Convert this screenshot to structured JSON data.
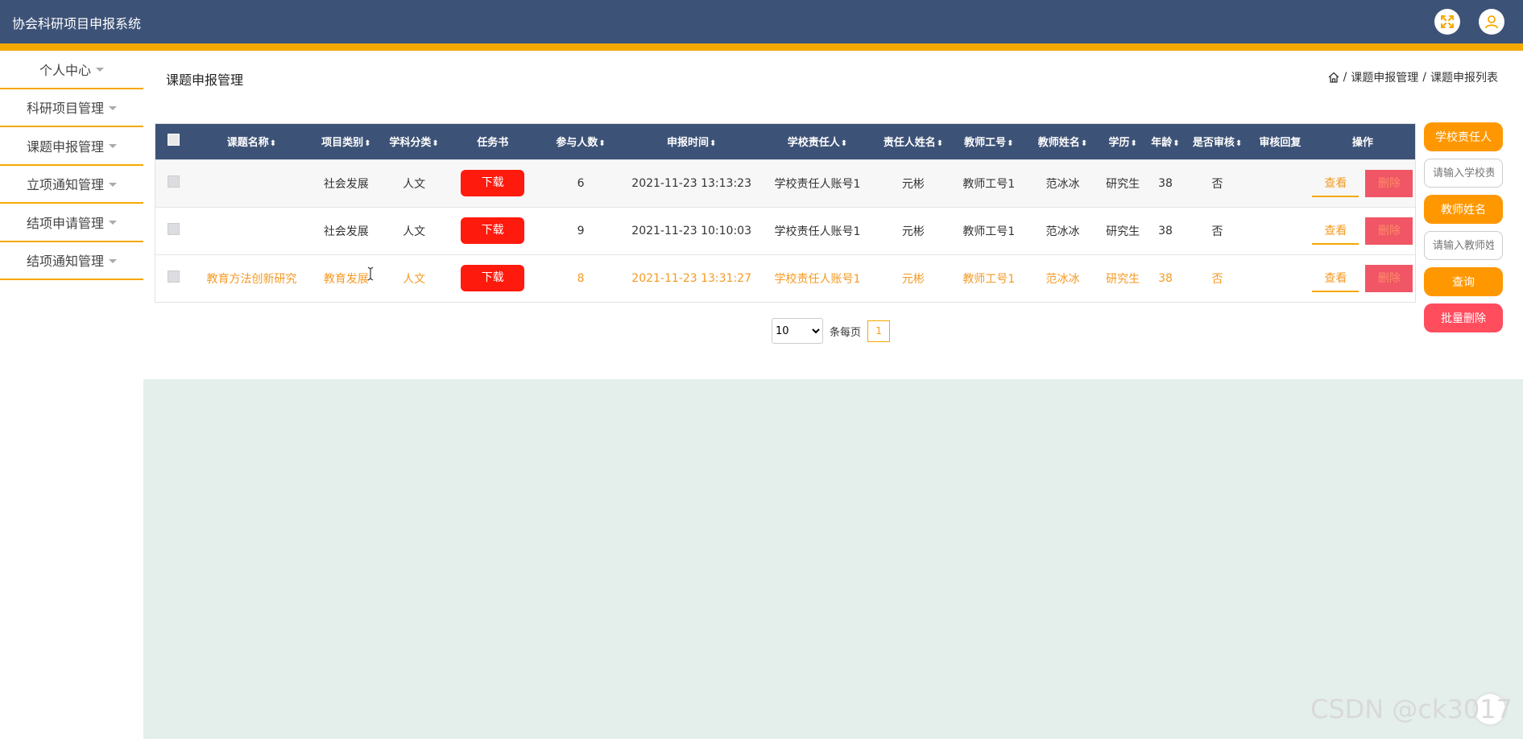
{
  "app": {
    "title": "协会科研项目申报系统"
  },
  "header": {
    "icons": [
      "fullscreen-icon",
      "user-icon"
    ]
  },
  "sidebar": {
    "items": [
      {
        "label": "个人中心"
      },
      {
        "label": "科研项目管理"
      },
      {
        "label": "课题申报管理"
      },
      {
        "label": "立项通知管理"
      },
      {
        "label": "结项申请管理"
      },
      {
        "label": "结项通知管理"
      }
    ]
  },
  "main": {
    "title": "课题申报管理"
  },
  "breadcrumb": {
    "home_icon": "home-icon",
    "items": [
      "课题申报管理",
      "课题申报列表"
    ],
    "sep": "/"
  },
  "table": {
    "headers": {
      "name": "课题名称",
      "category": "项目类别",
      "subject": "学科分类",
      "task": "任务书",
      "count": "参与人数",
      "time": "申报时间",
      "account": "学校责任人",
      "resp_name": "责任人姓名",
      "teacher_id": "教师工号",
      "teacher_name": "教师姓名",
      "edu": "学历",
      "age": "年龄",
      "audit": "是否审核",
      "reply": "审核回复",
      "ops": "操作"
    },
    "download_label": "下载",
    "view_label": "查看",
    "delete_label": "删除",
    "rows": [
      {
        "name": "",
        "category": "社会发展",
        "subject": "人文",
        "count": "6",
        "time": "2021-11-23 13:13:23",
        "account": "学校责任人账号1",
        "resp_name": "元彬",
        "teacher_id": "教师工号1",
        "teacher_name": "范冰冰",
        "edu": "研究生",
        "age": "38",
        "audit": "否",
        "reply": ""
      },
      {
        "name": "",
        "category": "社会发展",
        "subject": "人文",
        "count": "9",
        "time": "2021-11-23 10:10:03",
        "account": "学校责任人账号1",
        "resp_name": "元彬",
        "teacher_id": "教师工号1",
        "teacher_name": "范冰冰",
        "edu": "研究生",
        "age": "38",
        "audit": "否",
        "reply": ""
      },
      {
        "name": "教育方法创新研究",
        "category": "教育发展",
        "subject": "人文",
        "count": "8",
        "time": "2021-11-23 13:31:27",
        "account": "学校责任人账号1",
        "resp_name": "元彬",
        "teacher_id": "教师工号1",
        "teacher_name": "范冰冰",
        "edu": "研究生",
        "age": "38",
        "audit": "否",
        "reply": ""
      }
    ]
  },
  "pager": {
    "page_size": "10",
    "per_page_label": "条每页",
    "current_page": "1"
  },
  "search_panel": {
    "account_label": "学校责任人",
    "account_placeholder": "请输入学校责",
    "teacher_label": "教师姓名",
    "teacher_placeholder": "请输入教师姓",
    "search_label": "查询",
    "batch_delete_label": "批量删除"
  },
  "watermark": "CSDN @ck3017",
  "colors": {
    "header": "#3d5277",
    "accent": "#f5a800",
    "download": "#ff1a0e",
    "delete": "#f05666"
  }
}
